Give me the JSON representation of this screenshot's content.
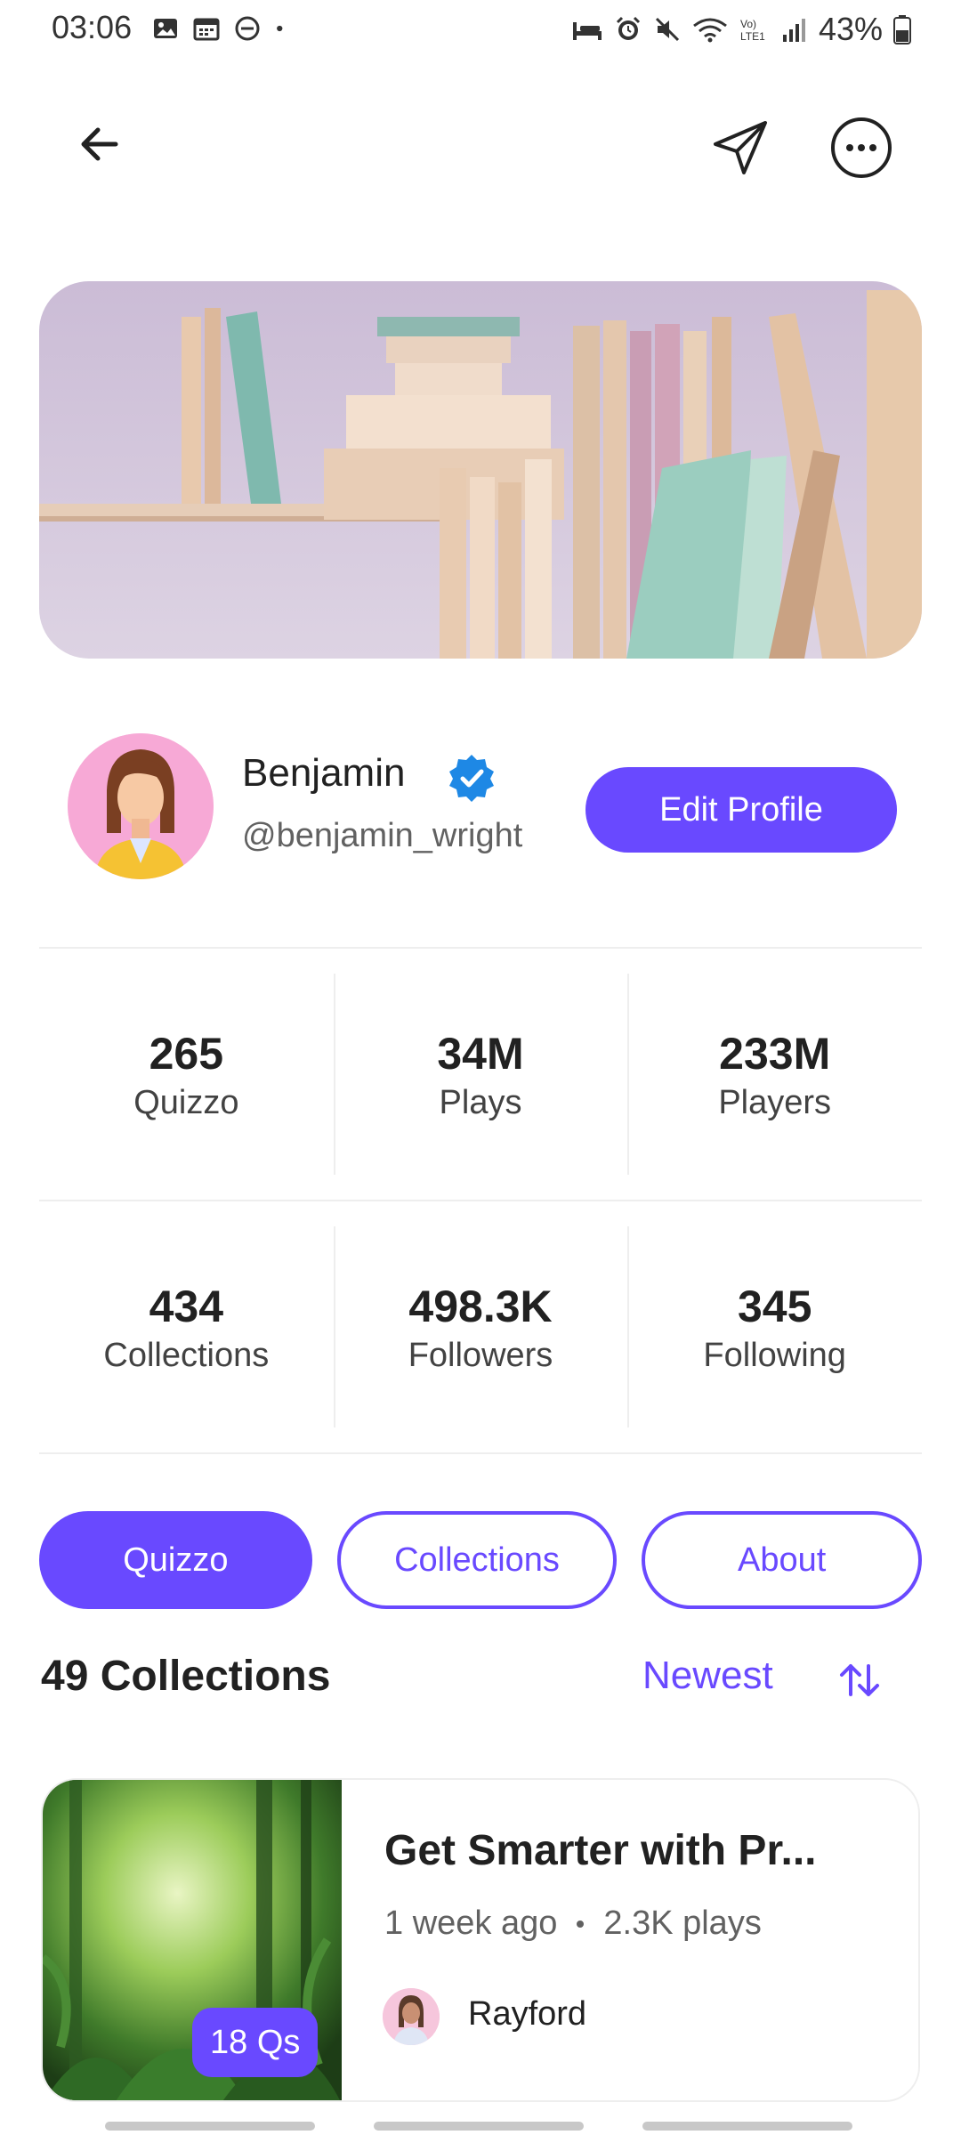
{
  "status_bar": {
    "time": "03:06",
    "battery": "43%",
    "left_icons": [
      "image-icon",
      "calendar-icon",
      "dnd-icon",
      "dot-icon"
    ],
    "right_icons": [
      "bed-icon",
      "alarm-icon",
      "mute-icon",
      "wifi-icon",
      "volte-icon",
      "signal-icon",
      "battery-icon"
    ]
  },
  "header": {
    "icons": [
      "back-arrow-icon",
      "send-icon",
      "more-icon"
    ]
  },
  "profile": {
    "name": "Benjamin",
    "handle": "@benjamin_wright",
    "verified": true,
    "edit_label": "Edit Profile"
  },
  "stats": [
    {
      "value": "265",
      "label": "Quizzo"
    },
    {
      "value": "34M",
      "label": "Plays"
    },
    {
      "value": "233M",
      "label": "Players"
    },
    {
      "value": "434",
      "label": "Collections"
    },
    {
      "value": "498.3K",
      "label": "Followers"
    },
    {
      "value": "345",
      "label": "Following"
    }
  ],
  "tabs": [
    {
      "label": "Quizzo",
      "active": true
    },
    {
      "label": "Collections",
      "active": false
    },
    {
      "label": "About",
      "active": false
    }
  ],
  "section": {
    "title": "49 Collections",
    "sort_label": "Newest"
  },
  "collection_card": {
    "title": "Get Smarter with Pr...",
    "time": "1 week ago",
    "plays": "2.3K plays",
    "badge": "18 Qs",
    "author": "Rayford"
  },
  "colors": {
    "accent": "#6949ff",
    "text": "#212121",
    "muted": "#616161",
    "divider": "#eeeeee"
  }
}
